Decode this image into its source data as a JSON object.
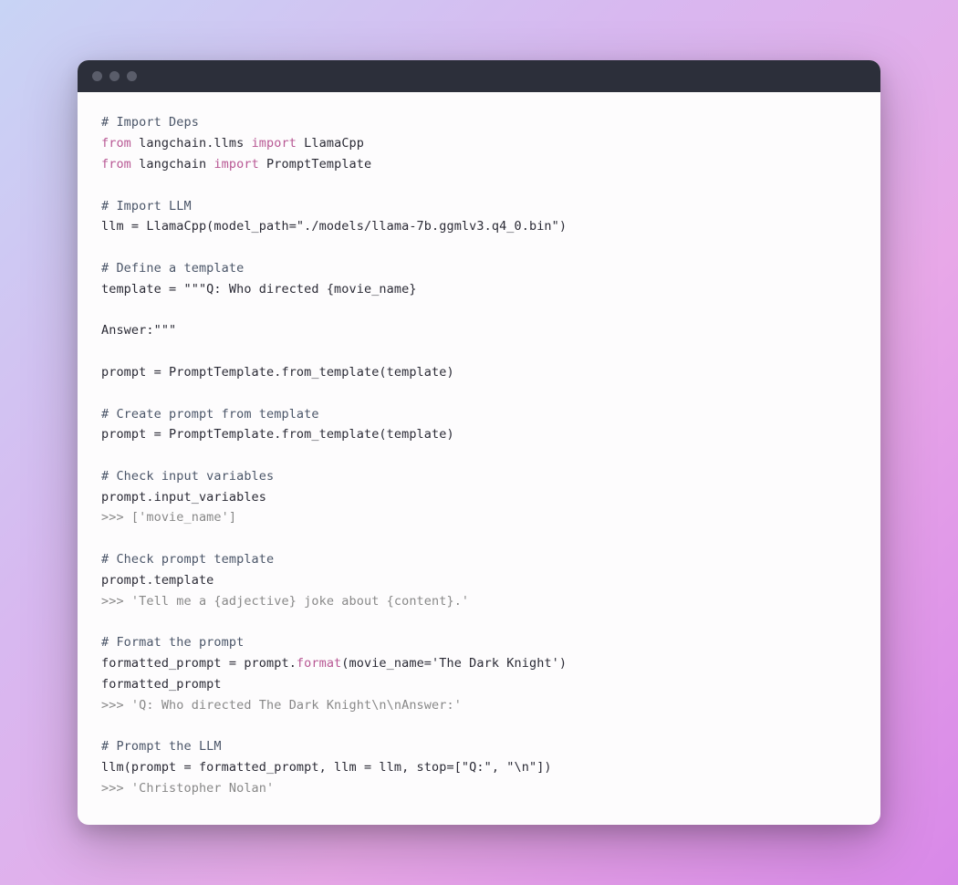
{
  "code": {
    "lines": [
      {
        "type": "comment",
        "text": "# Import Deps"
      },
      {
        "type": "code",
        "spans": [
          {
            "cls": "keyword",
            "text": "from"
          },
          {
            "cls": "plain",
            "text": " langchain.llms "
          },
          {
            "cls": "keyword",
            "text": "import"
          },
          {
            "cls": "plain",
            "text": " LlamaCpp"
          }
        ]
      },
      {
        "type": "code",
        "spans": [
          {
            "cls": "keyword",
            "text": "from"
          },
          {
            "cls": "plain",
            "text": " langchain "
          },
          {
            "cls": "keyword",
            "text": "import"
          },
          {
            "cls": "plain",
            "text": " PromptTemplate"
          }
        ]
      },
      {
        "type": "blank"
      },
      {
        "type": "comment",
        "text": "# Import LLM"
      },
      {
        "type": "plain",
        "text": "llm = LlamaCpp(model_path=\"./models/llama-7b.ggmlv3.q4_0.bin\")"
      },
      {
        "type": "blank"
      },
      {
        "type": "comment",
        "text": "# Define a template"
      },
      {
        "type": "plain",
        "text": "template = \"\"\"Q: Who directed {movie_name}"
      },
      {
        "type": "blank"
      },
      {
        "type": "plain",
        "text": "Answer:\"\"\""
      },
      {
        "type": "blank"
      },
      {
        "type": "plain",
        "text": "prompt = PromptTemplate.from_template(template)"
      },
      {
        "type": "blank"
      },
      {
        "type": "comment",
        "text": "# Create prompt from template"
      },
      {
        "type": "plain",
        "text": "prompt = PromptTemplate.from_template(template)"
      },
      {
        "type": "blank"
      },
      {
        "type": "comment",
        "text": "# Check input variables"
      },
      {
        "type": "plain",
        "text": "prompt.input_variables"
      },
      {
        "type": "output",
        "text": ">>> ['movie_name']"
      },
      {
        "type": "blank"
      },
      {
        "type": "comment",
        "text": "# Check prompt template"
      },
      {
        "type": "plain",
        "text": "prompt.template"
      },
      {
        "type": "output",
        "text": ">>> 'Tell me a {adjective} joke about {content}.'"
      },
      {
        "type": "blank"
      },
      {
        "type": "comment",
        "text": "# Format the prompt"
      },
      {
        "type": "code",
        "spans": [
          {
            "cls": "plain",
            "text": "formatted_prompt = prompt."
          },
          {
            "cls": "func",
            "text": "format"
          },
          {
            "cls": "plain",
            "text": "(movie_name='The Dark Knight')"
          }
        ]
      },
      {
        "type": "plain",
        "text": "formatted_prompt"
      },
      {
        "type": "output",
        "text": ">>> 'Q: Who directed The Dark Knight\\n\\nAnswer:'"
      },
      {
        "type": "blank"
      },
      {
        "type": "comment",
        "text": "# Prompt the LLM"
      },
      {
        "type": "plain",
        "text": "llm(prompt = formatted_prompt, llm = llm, stop=[\"Q:\", \"\\n\"])"
      },
      {
        "type": "output",
        "text": ">>> 'Christopher Nolan'"
      }
    ]
  }
}
